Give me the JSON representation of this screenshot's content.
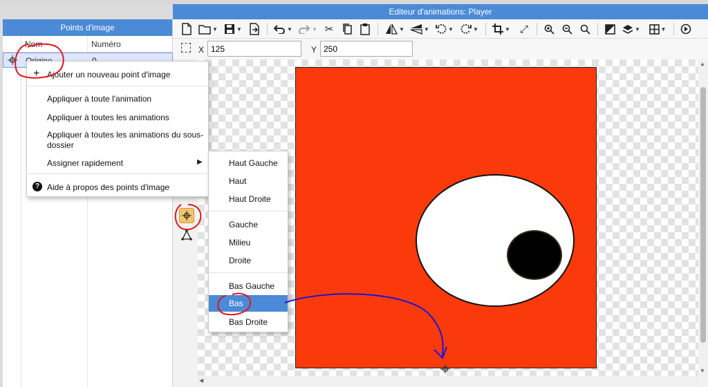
{
  "window": {
    "title": "Editeur d'animations: Player"
  },
  "left_panel": {
    "title": "Points d'image",
    "columns": {
      "name": "Nom",
      "number": "Numéro"
    },
    "rows": [
      {
        "name": "Origine",
        "number": "0"
      }
    ]
  },
  "coords": {
    "x_label": "X",
    "x_value": "125",
    "y_label": "Y",
    "y_value": "250"
  },
  "context_menu": {
    "add_point": "Ajouter un nouveau point d'image",
    "apply_animation": "Appliquer à toute l'animation",
    "apply_all": "Appliquer à toutes les animations",
    "apply_subfolder_line1": "Appliquer à toutes les animations du sous-",
    "apply_subfolder_line2": "dossier",
    "quick_assign": "Assigner rapidement",
    "help": "Aide à propos des points d'image"
  },
  "quick_assign_menu": {
    "items": [
      "Haut Gauche",
      "Haut",
      "Haut Droite",
      "Gauche",
      "Milieu",
      "Droite",
      "Bas Gauche",
      "Bas",
      "Bas Droite"
    ],
    "selected": "Bas"
  },
  "colors": {
    "accent": "#4b8ad6",
    "sprite_bg": "#fb3a0c",
    "annotation_red": "#e0141e",
    "annotation_blue": "#1a14d6"
  },
  "icons": [
    "new-file-icon",
    "open-folder-icon",
    "save-icon",
    "export-icon",
    "undo-icon",
    "redo-icon",
    "cut-icon",
    "copy-icon",
    "paste-icon",
    "flip-horizontal-icon",
    "flip-vertical-icon",
    "rotate-left-icon",
    "rotate-right-icon",
    "crop-icon",
    "resize-icon",
    "zoom-in-icon",
    "zoom-out-icon",
    "zoom-fit-icon",
    "color-icon",
    "layers-icon",
    "grid-icon",
    "play-icon"
  ]
}
